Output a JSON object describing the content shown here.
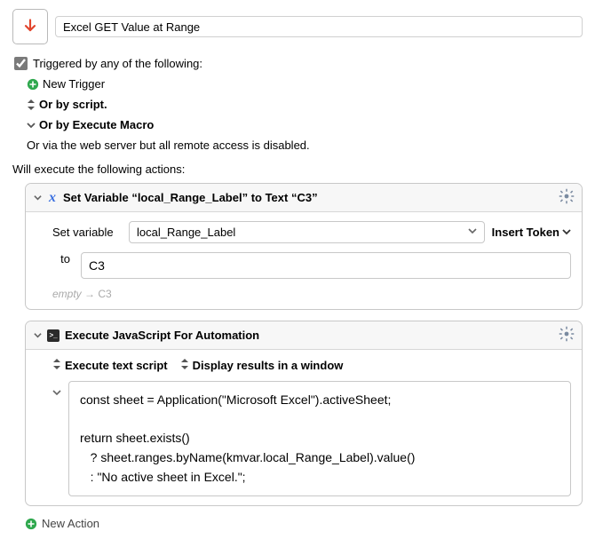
{
  "header": {
    "title": "Excel GET Value at Range"
  },
  "triggered_label": "Triggered by any of the following:",
  "new_trigger": "New Trigger",
  "or_script": "Or by script.",
  "or_execute_macro": "Or by Execute Macro",
  "remote_disabled": "Or via the web server but all remote access is disabled.",
  "will_execute": "Will execute the following actions:",
  "action1": {
    "title": "Set Variable “local_Range_Label” to Text “C3”",
    "set_variable_label": "Set variable",
    "var_name": "local_Range_Label",
    "insert_token": "Insert Token",
    "to_label": "to",
    "to_value": "C3",
    "hint_empty": "empty",
    "hint_arrow": "→",
    "hint_result": "C3"
  },
  "action2": {
    "title": "Execute JavaScript For Automation",
    "opt_script": "Execute text script",
    "opt_display": "Display results in a window",
    "code": "const sheet = Application(\"Microsoft Excel\").activeSheet;\n\nreturn sheet.exists()\n   ? sheet.ranges.byName(kmvar.local_Range_Label).value()\n   : \"No active sheet in Excel.\";"
  },
  "new_action": "New Action"
}
